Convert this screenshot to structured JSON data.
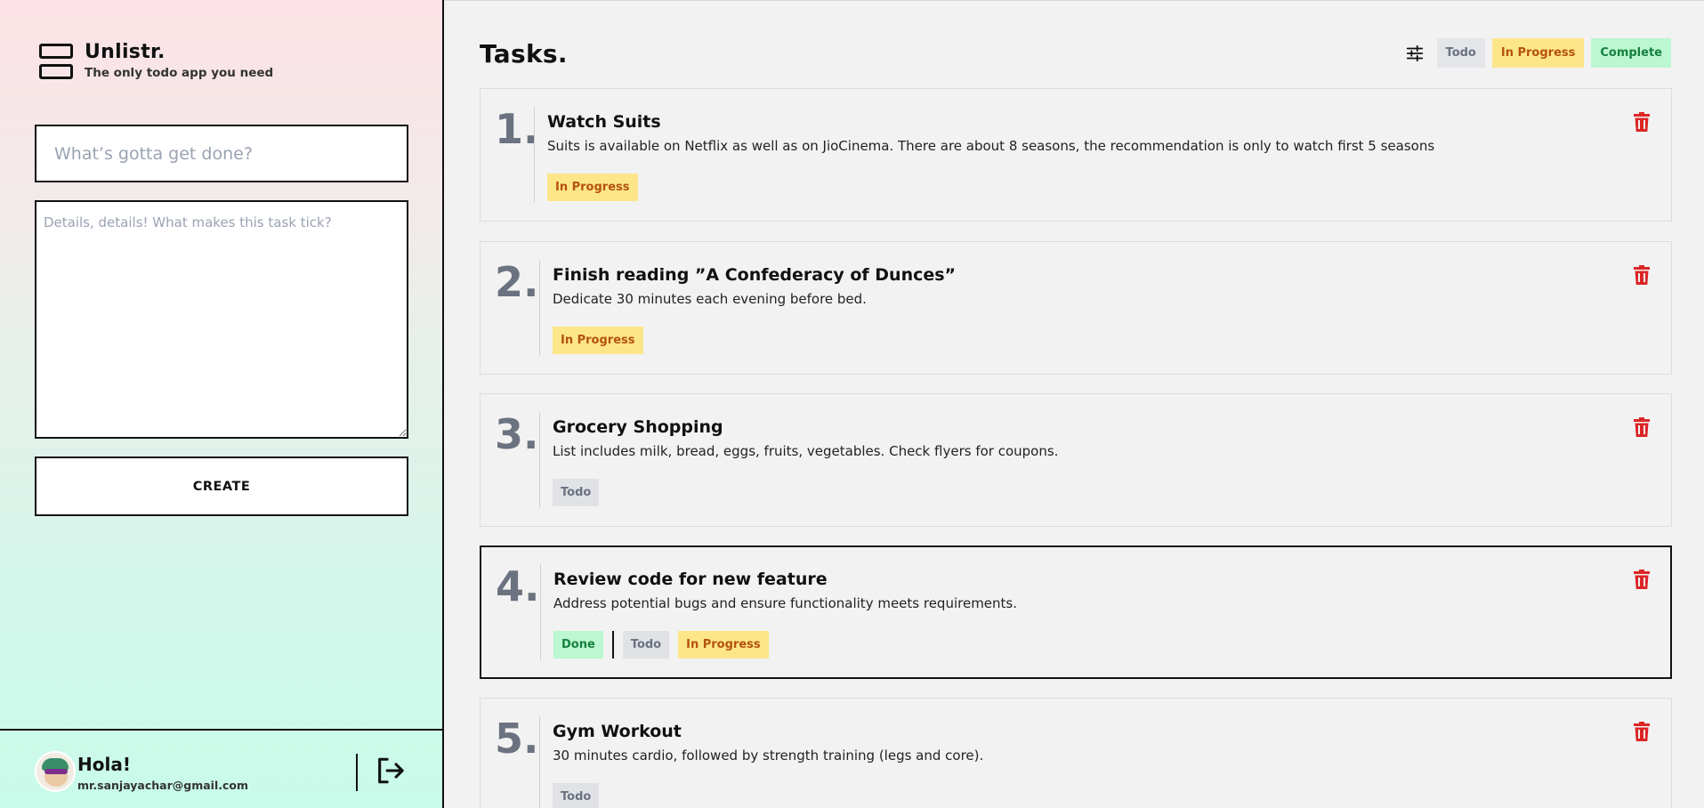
{
  "brand": {
    "title": "Unlistr.",
    "subtitle": "The only todo app you need"
  },
  "form": {
    "title_placeholder": "What’s gotta get done?",
    "title_value": "",
    "details_placeholder": "Details, details! What makes this task tick?",
    "details_value": "",
    "create_label": "CREATE"
  },
  "user": {
    "greeting": "Hola!",
    "email": "mr.sanjayachar@gmail.com"
  },
  "main": {
    "title": "Tasks.",
    "filters": {
      "icon": "sliders-icon",
      "todo": "Todo",
      "in_progress": "In Progress",
      "complete": "Complete"
    }
  },
  "tasks": [
    {
      "number": "1.",
      "title": "Watch Suits",
      "description": "Suits is available on Netflix as well as on JioCinema. There are about 8 seasons, the recommendation is only to watch first 5 seasons",
      "status": "In Progress"
    },
    {
      "number": "2.",
      "title": "Finish reading ”A Confederacy of Dunces”",
      "description": "Dedicate 30 minutes each evening before bed.",
      "status": "In Progress"
    },
    {
      "number": "3.",
      "title": "Grocery Shopping",
      "description": "List includes milk, bread, eggs, fruits, vegetables. Check flyers for coupons.",
      "status": "Todo"
    },
    {
      "number": "4.",
      "title": "Review code for new feature",
      "description": "Address potential bugs and ensure functionality meets requirements.",
      "status": "Done",
      "options": [
        "Todo",
        "In Progress"
      ]
    },
    {
      "number": "5.",
      "title": "Gym Workout",
      "description": "30 minutes cardio, followed by strength training (legs and core).",
      "status": "Todo"
    }
  ],
  "colors": {
    "todo_bg": "#e0e2e6",
    "progress_bg": "#fde68a",
    "done_bg": "#bbf7d0",
    "trash": "#dc2626"
  }
}
